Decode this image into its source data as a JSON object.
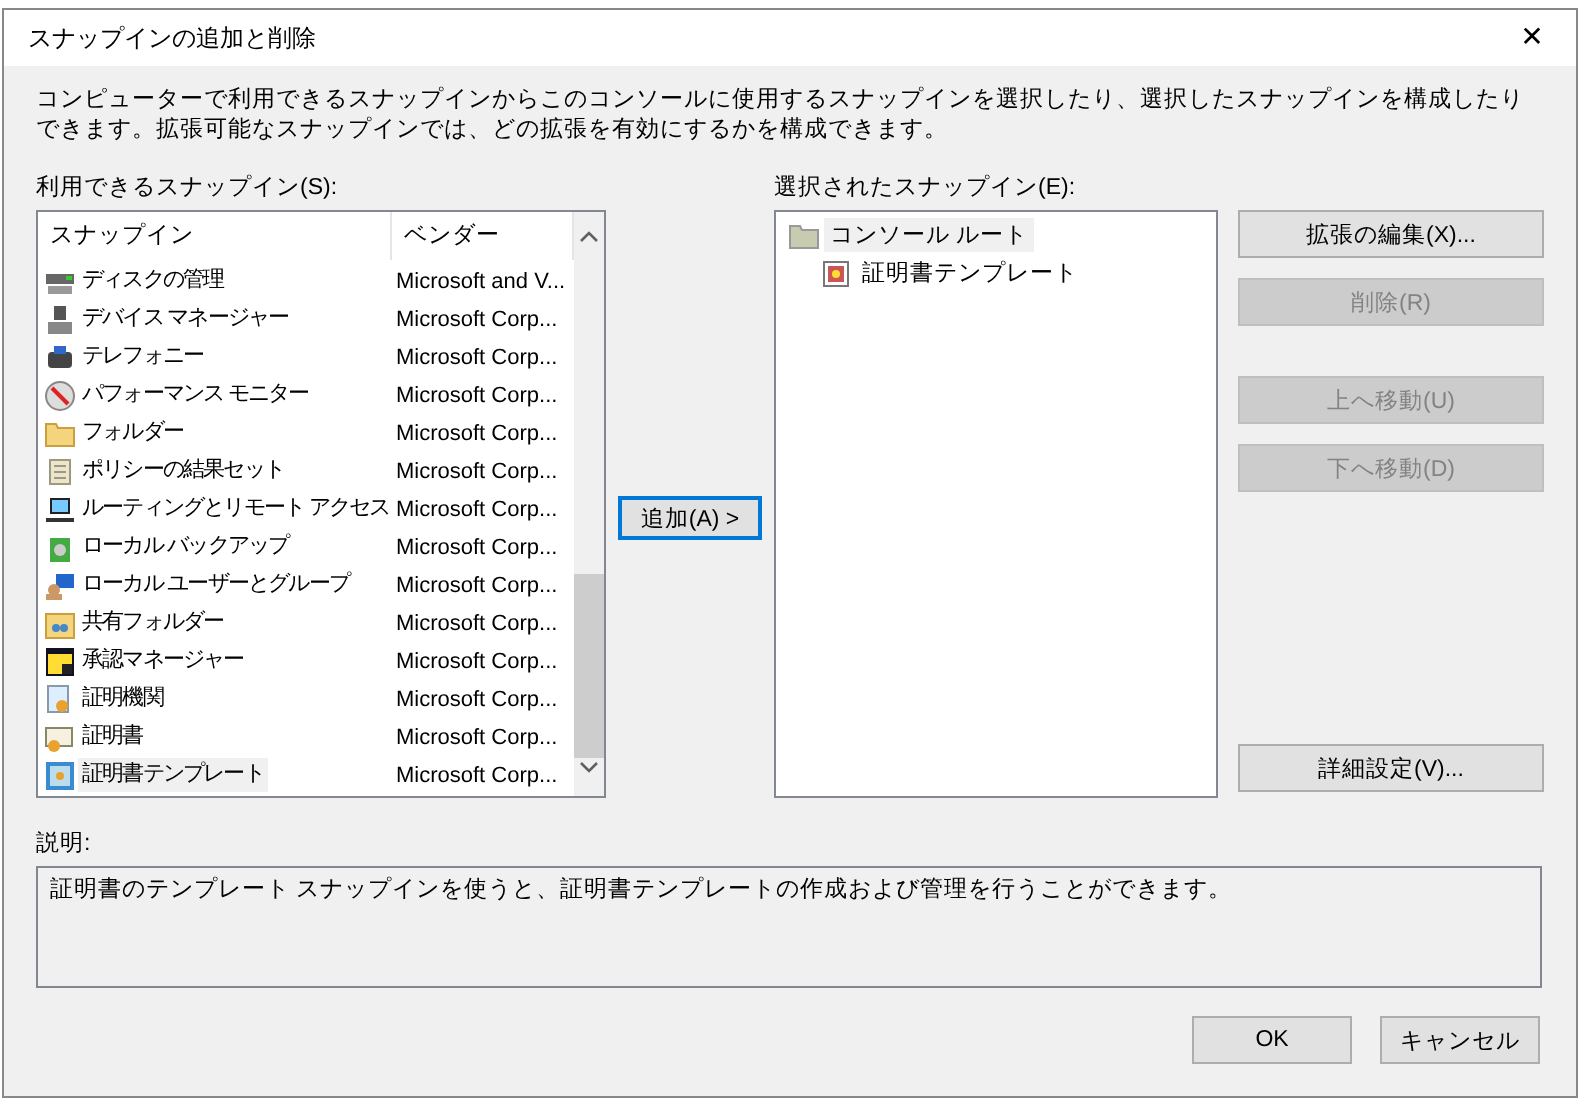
{
  "window": {
    "title": "スナップインの追加と削除",
    "close": "✕"
  },
  "intro": "コンピューターで利用できるスナップインからこのコンソールに使用するスナップインを選択したり、選択したスナップインを構成したりできます。拡張可能なスナップインでは、どの拡張を有効にするかを構成できます。",
  "available": {
    "label": "利用できるスナップイン(S):",
    "columns": [
      "スナップイン",
      "ベンダー"
    ],
    "rows": [
      {
        "name": "ディスクの管理",
        "vendor": "Microsoft and V...",
        "selected": false
      },
      {
        "name": "デバイス マネージャー",
        "vendor": "Microsoft Corp...",
        "selected": false
      },
      {
        "name": "テレフォニー",
        "vendor": "Microsoft Corp...",
        "selected": false
      },
      {
        "name": "パフォーマンス モニター",
        "vendor": "Microsoft Corp...",
        "selected": false
      },
      {
        "name": "フォルダー",
        "vendor": "Microsoft Corp...",
        "selected": false
      },
      {
        "name": "ポリシーの結果セット",
        "vendor": "Microsoft Corp...",
        "selected": false
      },
      {
        "name": "ルーティングとリモート アクセス",
        "vendor": "Microsoft Corp...",
        "selected": false
      },
      {
        "name": "ローカル バックアップ",
        "vendor": "Microsoft Corp...",
        "selected": false
      },
      {
        "name": "ローカル ユーザーとグループ",
        "vendor": "Microsoft Corp...",
        "selected": false
      },
      {
        "name": "共有フォルダー",
        "vendor": "Microsoft Corp...",
        "selected": false
      },
      {
        "name": "承認マネージャー",
        "vendor": "Microsoft Corp...",
        "selected": false
      },
      {
        "name": "証明機関",
        "vendor": "Microsoft Corp...",
        "selected": false
      },
      {
        "name": "証明書",
        "vendor": "Microsoft Corp...",
        "selected": false
      },
      {
        "name": "証明書テンプレート",
        "vendor": "Microsoft Corp...",
        "selected": true
      }
    ]
  },
  "add_button": {
    "label": "追加(A) >",
    "focused": true
  },
  "selected_snapins": {
    "label": "選択されたスナップイン(E):",
    "tree": [
      {
        "label": "コンソール ルート",
        "selected": true,
        "children": [
          {
            "label": "証明書テンプレート",
            "selected": false
          }
        ]
      }
    ]
  },
  "side_buttons": [
    {
      "label": "拡張の編集(X)...",
      "disabled": false
    },
    {
      "label": "削除(R)",
      "disabled": true
    },
    {
      "label": "上へ移動(U)",
      "disabled": true
    },
    {
      "label": "下へ移動(D)",
      "disabled": true
    },
    {
      "label": "詳細設定(V)...",
      "disabled": false
    }
  ],
  "description": {
    "label": "説明:",
    "text": "証明書のテンプレート スナップインを使うと、証明書テンプレートの作成および管理を行うことができます。"
  },
  "buttons": [
    {
      "label": "OK"
    },
    {
      "label": "キャンセル"
    }
  ]
}
